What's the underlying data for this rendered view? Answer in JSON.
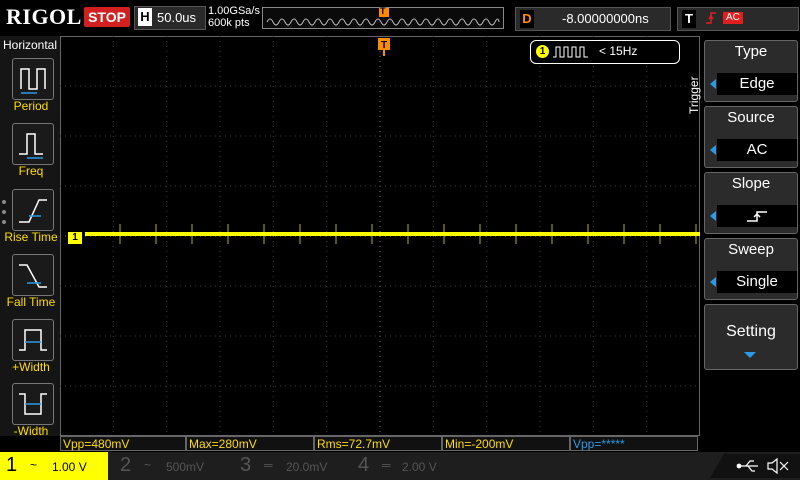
{
  "brand": "RIGOL",
  "run_state": "STOP",
  "timebase": {
    "label": "H",
    "value": "50.0us"
  },
  "sample": {
    "rate": "1.00GSa/s",
    "points": "600k pts"
  },
  "trigger_pos_marker": "T",
  "delay": {
    "label": "D",
    "value": "-8.00000000ns"
  },
  "trigger_status": {
    "label": "T",
    "source": "AC"
  },
  "left_menu": {
    "title": "Horizontal",
    "items": [
      {
        "label": "Period"
      },
      {
        "label": "Freq"
      },
      {
        "label": "Rise Time"
      },
      {
        "label": "Fall Time"
      },
      {
        "label": "+Width"
      },
      {
        "label": "-Width"
      }
    ]
  },
  "freq_readout": {
    "channel": "1",
    "text": "< 15Hz"
  },
  "trigger_menu": {
    "side_label": "Trigger",
    "type": {
      "title": "Type",
      "value": "Edge"
    },
    "source": {
      "title": "Source",
      "value": "AC"
    },
    "slope": {
      "title": "Slope"
    },
    "sweep": {
      "title": "Sweep",
      "value": "Single"
    },
    "setting": {
      "title": "Setting"
    }
  },
  "channel_marker": "1",
  "measurements": [
    "Vpp=480mV",
    "Max=280mV",
    "Rms=72.7mV",
    "Min=-200mV",
    "Vpp=*****"
  ],
  "channels": [
    {
      "num": "1",
      "scale": "1.00 V",
      "color": "#ffff00"
    },
    {
      "num": "2",
      "scale": "500mV",
      "color": "#00c0ff"
    },
    {
      "num": "3",
      "scale": "20.0mV",
      "color": "#ff00ff"
    },
    {
      "num": "4",
      "scale": "2.00 V",
      "color": "#3070ff"
    }
  ],
  "colors": {
    "ch1": "#ffff00",
    "accent": "#2b9be8",
    "stop": "#d02020",
    "trigger": "#ff8c00"
  }
}
